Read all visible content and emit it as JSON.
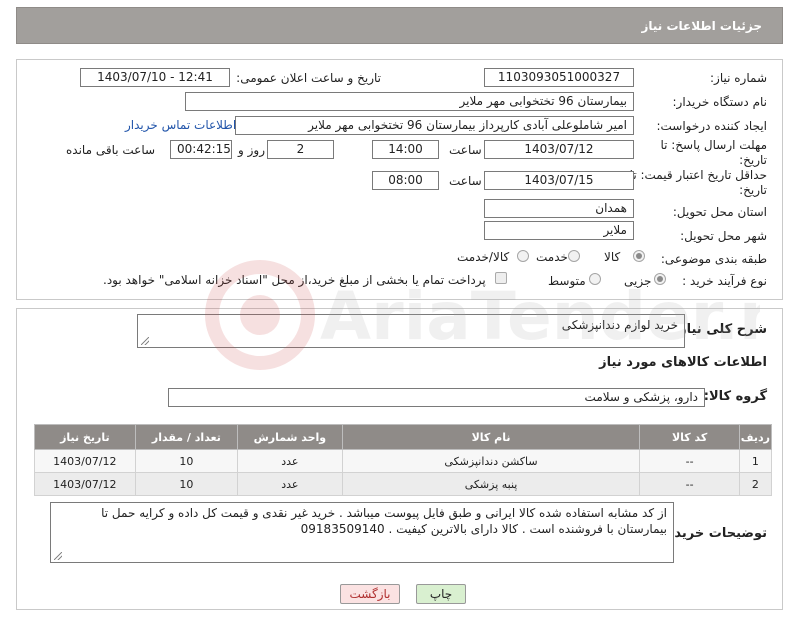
{
  "header": {
    "title": "جزئیات اطلاعات نیاز"
  },
  "labels": {
    "need_number": "شماره نیاز:",
    "announce_datetime": "تاریخ و ساعت اعلان عمومی:",
    "buyer_org": "نام دستگاه خریدار:",
    "requester": "ایجاد کننده درخواست:",
    "deadline": "مهلت ارسال پاسخ: تا تاریخ:",
    "min_price_validity": "حداقل تاریخ اعتبار قیمت: تا تاریخ:",
    "hour": "ساعت",
    "day_and": "روز و",
    "hours_left": "ساعت باقی مانده",
    "province": "استان محل تحویل:",
    "city": "شهر محل تحویل:",
    "category": "طبقه بندی موضوعی:",
    "process_type": "نوع فرآیند خرید :",
    "general_desc": "شرح کلی نیاز:",
    "goods_info": "اطلاعات کالاهای مورد نیاز",
    "goods_group": "گروه کالا:",
    "buyer_notes": "توضیحات خریدار:"
  },
  "fields": {
    "need_number": "1103093051000327",
    "announce_datetime": "1403/07/10 - 12:41",
    "buyer_org": "بیمارستان 96 تختخوابی مهر ملایر",
    "requester": "امیر شاملوعلی آبادی کارپرداز بیمارستان 96 تختخوابی مهر ملایر",
    "contact_link": "اطلاعات تماس خریدار",
    "deadline_date": "1403/07/12",
    "deadline_time": "14:00",
    "days_left": "2",
    "time_left": "00:42:15",
    "validity_date": "1403/07/15",
    "validity_time": "08:00",
    "province": "همدان",
    "city": "ملایر",
    "general_desc": "خرید لوازم دندانپزشکی",
    "goods_group": "دارو، پزشکی و سلامت",
    "buyer_notes": "از کد مشابه استفاده شده کالا ایرانی و طبق فایل پیوست میباشد . خرید غیر نقدی و قیمت کل داده و کرایه حمل تا بیمارستان با فروشنده است . کالا دارای بالاترین کیفیت .   09183509140"
  },
  "category_options": [
    "کالا",
    "خدمت",
    "کالا/خدمت"
  ],
  "category_selected": "کالا",
  "process_options": [
    "جزیی",
    "متوسط"
  ],
  "process_selected": "جزیی",
  "payment_note": "پرداخت تمام یا بخشی از مبلغ خرید،از محل \"اسناد خزانه اسلامی\" خواهد بود.",
  "table": {
    "headers": [
      "ردیف",
      "کد کالا",
      "نام کالا",
      "واحد شمارش",
      "تعداد / مقدار",
      "تاریخ نیاز"
    ],
    "rows": [
      [
        "1",
        "--",
        "ساکشن دندانپزشکی",
        "عدد",
        "10",
        "1403/07/12"
      ],
      [
        "2",
        "--",
        "پنبه پزشکی",
        "عدد",
        "10",
        "1403/07/12"
      ]
    ]
  },
  "buttons": {
    "print": "چاپ",
    "back": "بازگشت"
  },
  "watermark": "AriaTender.neT",
  "colors": {
    "header_bg": "#a29f9c",
    "table_header_bg": "#8f8b88",
    "link": "#2255aa",
    "print_bg": "#d9f0d0",
    "back_bg": "#fbe2e2"
  }
}
